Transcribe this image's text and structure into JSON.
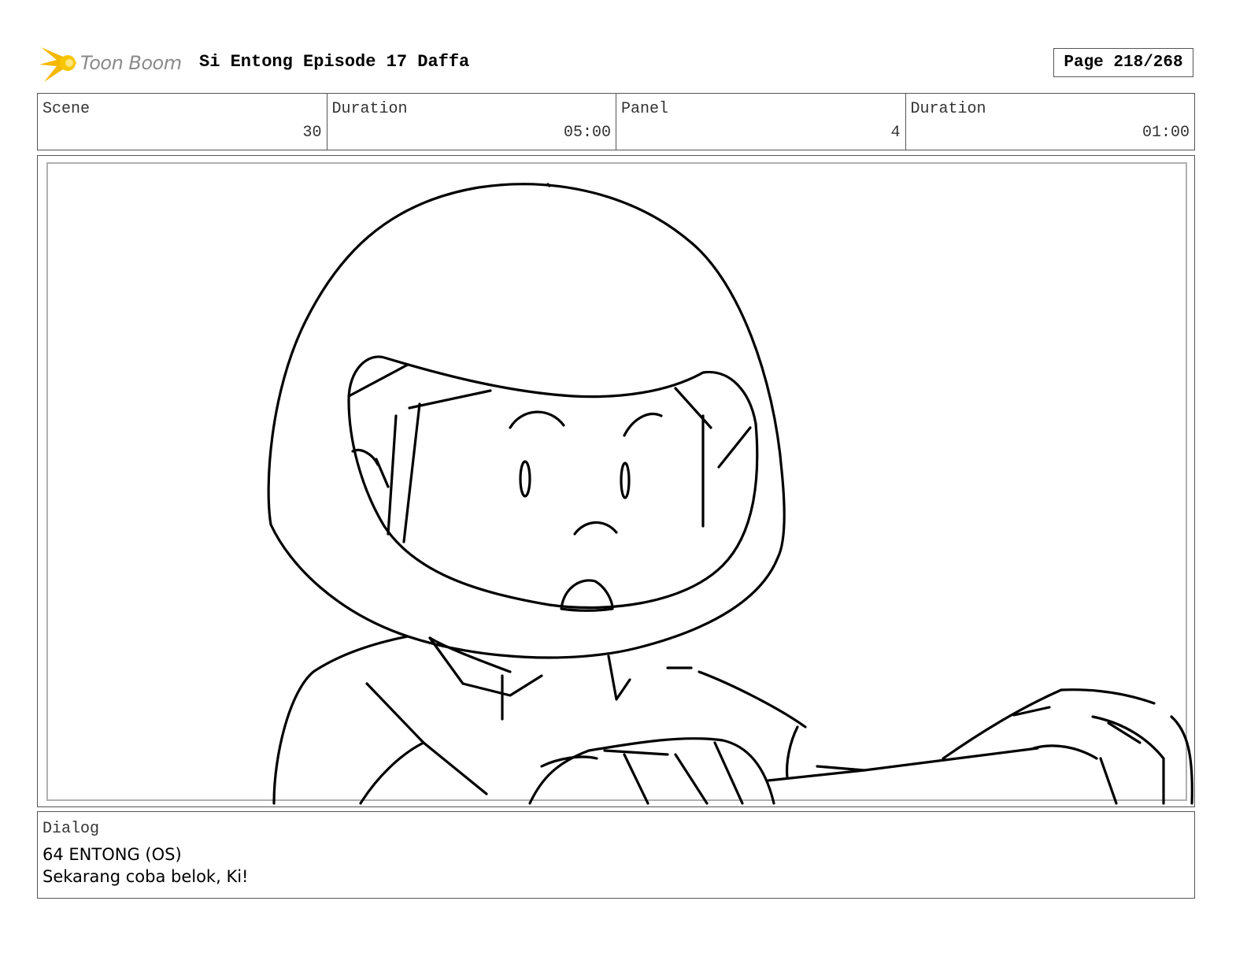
{
  "header": {
    "logo_text": "Toon Boom",
    "title": "Si Entong Episode 17 Daffa",
    "page": "Page 218/268"
  },
  "info": {
    "scene": {
      "label": "Scene",
      "value": "30"
    },
    "scene_duration": {
      "label": "Duration",
      "value": "05:00"
    },
    "panel": {
      "label": "Panel",
      "value": "4"
    },
    "panel_duration": {
      "label": "Duration",
      "value": "01:00"
    }
  },
  "dialog": {
    "label": "Dialog",
    "lines": [
      "64 ENTONG (OS)",
      "Sekarang coba belok, Ki!"
    ]
  },
  "colors": {
    "logo_star": "#f5b800",
    "logo_text": "#8a8a8a",
    "border": "#555555"
  },
  "icons": {
    "logo": "toon-boom-star-icon"
  }
}
